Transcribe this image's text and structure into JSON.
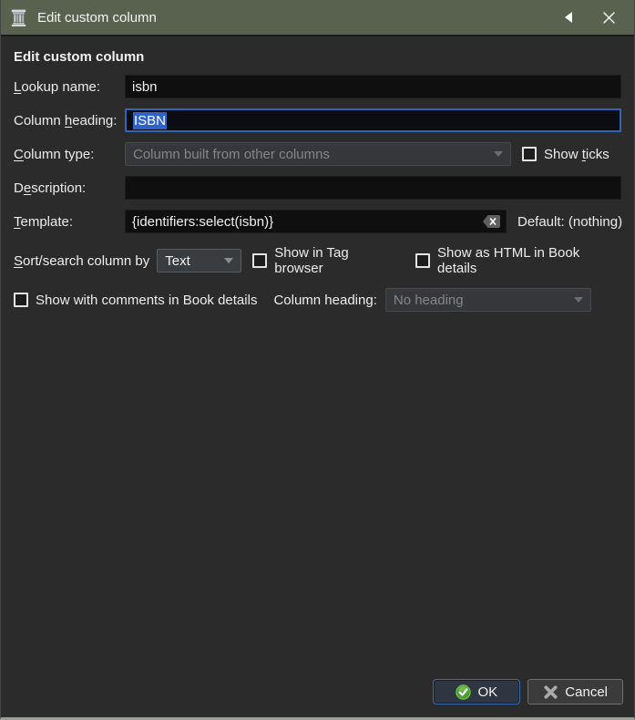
{
  "colors": {
    "titlebar_bg": "#59614f",
    "dialog_bg": "#2b2b2b",
    "input_bg": "#0f0f0f",
    "focus_border": "#3066b8",
    "selection_bg": "#2f62c4",
    "ok_button_border": "#3e6db5",
    "ok_icon_green": "#52a835",
    "window_bottom_edge": "#9aa096"
  },
  "titlebar": {
    "title": "Edit custom column",
    "app_icon": "column-pillar-icon",
    "shade_icon": "left-triangle-icon",
    "close_icon": "close-x-icon"
  },
  "heading": "Edit custom column",
  "form": {
    "lookup": {
      "label_key": "L",
      "label_post": "ookup name:",
      "value": "isbn"
    },
    "column_heading": {
      "label_pre": "Column ",
      "label_key": "h",
      "label_post": "eading:",
      "value": "ISBN",
      "selected": true
    },
    "column_type": {
      "label_key": "C",
      "label_post": "olumn type:",
      "value": "Column built from other columns",
      "disabled": true,
      "show_ticks": {
        "pre": "Show ",
        "key": "t",
        "post": "icks",
        "checked": false
      }
    },
    "description": {
      "label_pre": "D",
      "label_key": "e",
      "label_post": "scription:",
      "value": ""
    },
    "template": {
      "label_key": "T",
      "label_post": "emplate:",
      "value": "{identifiers:select(isbn)}",
      "clear_icon": "clear-field-icon",
      "default_note": "Default: (nothing)"
    },
    "sort": {
      "label_key": "S",
      "label_post": "ort/search column by",
      "value": "Text",
      "show_in_tag_browser": {
        "label": "Show in Tag browser",
        "checked": false
      },
      "show_as_html": {
        "label": "Show as HTML in Book details",
        "checked": false
      }
    },
    "comments_row": {
      "show_with_comments": {
        "label": "Show with comments in Book details",
        "checked": false
      },
      "heading_label": "Column heading:",
      "heading_value": "No heading",
      "heading_disabled": true
    }
  },
  "buttons": {
    "ok": "OK",
    "ok_icon": "green-check-icon",
    "cancel": "Cancel",
    "cancel_icon": "gray-x-icon"
  }
}
